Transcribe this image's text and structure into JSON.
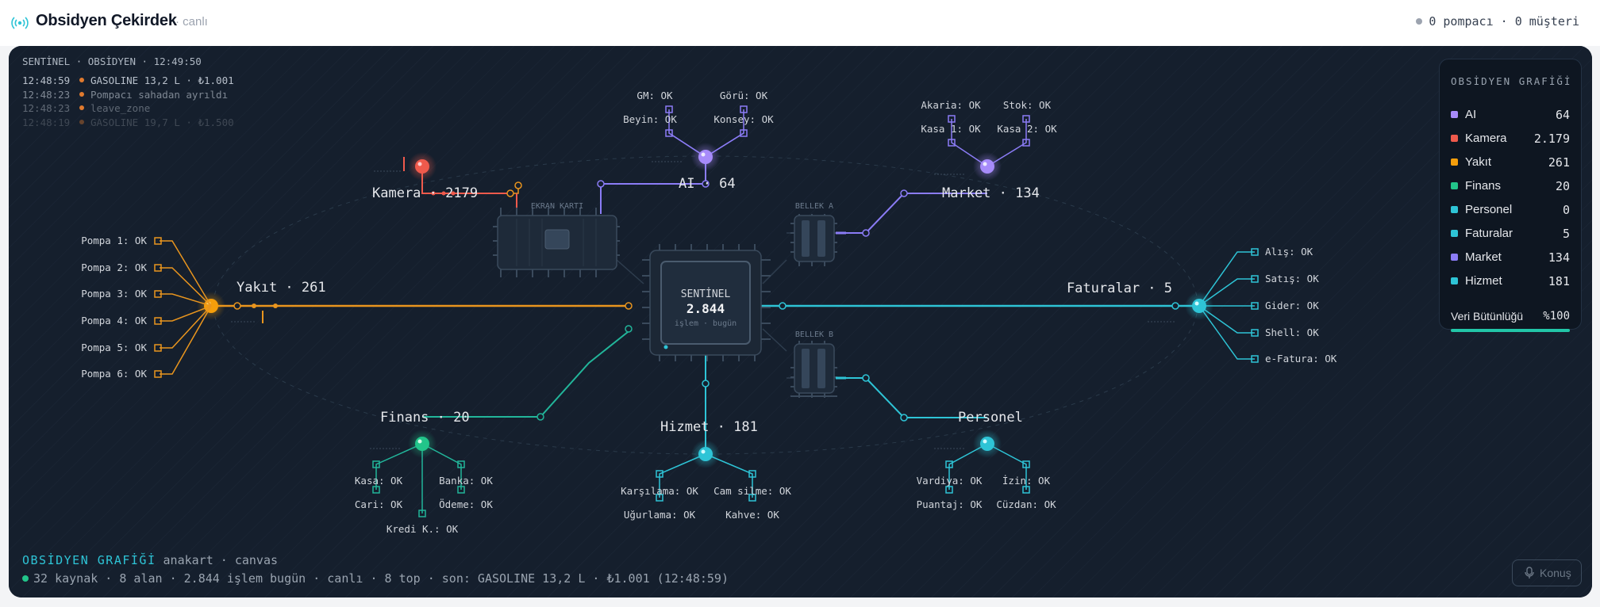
{
  "header": {
    "title": "Obsidyen Çekirdek",
    "status": "· canlı",
    "counts": "0 pompacı · 0 müşteri"
  },
  "board": {
    "header": "SENTİNEL · OBSİDYEN · 12:49:50",
    "log": [
      {
        "time": "12:48:59",
        "text": "GASOLINE 13,2 L · ₺1.001"
      },
      {
        "time": "12:48:23",
        "text": "Pompacı sahadan ayrıldı"
      },
      {
        "time": "12:48:23",
        "text": "leave_zone"
      },
      {
        "time": "12:48:19",
        "text": "GASOLINE 19,7 L · ₺1.500"
      }
    ],
    "core": {
      "title": "SENTİNEL",
      "value": "2.844",
      "sub": "işlem · bugün"
    },
    "chips": {
      "gpu": "EKRAN KARTI",
      "mem_a": "BELLEK A",
      "mem_b": "BELLEK B"
    },
    "nodes": {
      "kamera": "Kamera · 2179",
      "ai": "AI · 64",
      "market": "Market · 134",
      "yakit": "Yakıt · 261",
      "faturalar": "Faturalar · 5",
      "finans": "Finans · 20",
      "hizmet": "Hizmet · 181",
      "personel": "Personel"
    },
    "ai_subs": [
      "GM: OK",
      "Görü: OK",
      "Beyin: OK",
      "Konsey: OK"
    ],
    "market_subs": [
      "Akaria: OK",
      "Stok: OK",
      "Kasa 1: OK",
      "Kasa 2: OK"
    ],
    "pumps": [
      "Pompa 1: OK",
      "Pompa 2: OK",
      "Pompa 3: OK",
      "Pompa 4: OK",
      "Pompa 5: OK",
      "Pompa 6: OK"
    ],
    "fatura_subs": [
      "Alış: OK",
      "Satış: OK",
      "Gider: OK",
      "Shell: OK",
      "e-Fatura: OK"
    ],
    "finans_subs": [
      "Kasa: OK",
      "Banka: OK",
      "Cari: OK",
      "Ödeme: OK",
      "Kredi K.: OK"
    ],
    "hizmet_subs": [
      "Karşılama: OK",
      "Cam silme: OK",
      "Uğurlama: OK",
      "Kahve: OK"
    ],
    "personel_subs": [
      "Vardiya: OK",
      "İzin: OK",
      "Puantaj: OK",
      "Cüzdan: OK"
    ]
  },
  "legend": {
    "title": "OBSİDYEN GRAFİĞİ",
    "items": [
      {
        "name": "AI",
        "value": "64",
        "color": "#a78bfa"
      },
      {
        "name": "Kamera",
        "value": "2.179",
        "color": "#ef5a4c"
      },
      {
        "name": "Yakıt",
        "value": "261",
        "color": "#f59e0b"
      },
      {
        "name": "Finans",
        "value": "20",
        "color": "#22c58a"
      },
      {
        "name": "Personel",
        "value": "0",
        "color": "#2ec4d6"
      },
      {
        "name": "Faturalar",
        "value": "5",
        "color": "#2ec4d6"
      },
      {
        "name": "Market",
        "value": "134",
        "color": "#8b7cf6"
      },
      {
        "name": "Hizmet",
        "value": "181",
        "color": "#2ec4d6"
      }
    ],
    "integrity_label": "Veri Bütünlüğü",
    "integrity_value": "%100",
    "integrity_fraction": 1.0
  },
  "footer": {
    "title": "OBSİDYEN GRAFİĞİ",
    "subtitle": "anakart · canvas",
    "status": "32 kaynak · 8 alan · 2.844 işlem bugün · canlı · 8 top · son: GASOLINE 13,2 L · ₺1.001 (12:48:59)"
  },
  "konus": {
    "label": "Konuş"
  }
}
